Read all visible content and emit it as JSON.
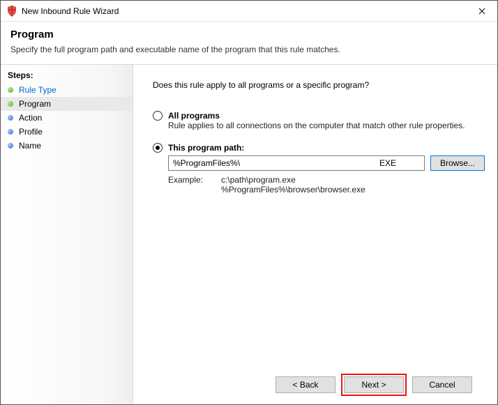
{
  "window": {
    "title": "New Inbound Rule Wizard"
  },
  "header": {
    "title": "Program",
    "subtitle": "Specify the full program path and executable name of the program that this rule matches."
  },
  "sidebar": {
    "heading": "Steps:",
    "items": [
      {
        "label": "Rule Type",
        "state": "completed"
      },
      {
        "label": "Program",
        "state": "current"
      },
      {
        "label": "Action",
        "state": "pending"
      },
      {
        "label": "Profile",
        "state": "pending"
      },
      {
        "label": "Name",
        "state": "pending"
      }
    ]
  },
  "content": {
    "question": "Does this rule apply to all programs or a specific program?",
    "options": {
      "all": {
        "label": "All programs",
        "desc": "Rule applies to all connections on the computer that match other rule properties.",
        "selected": false
      },
      "path": {
        "label": "This program path:",
        "selected": true,
        "value": "%ProgramFiles%\\",
        "ext_hint": "EXE",
        "browse_label": "Browse...",
        "example_label": "Example:",
        "example_paths": "c:\\path\\program.exe\n%ProgramFiles%\\browser\\browser.exe"
      }
    }
  },
  "footer": {
    "back": "< Back",
    "next": "Next >",
    "cancel": "Cancel"
  }
}
